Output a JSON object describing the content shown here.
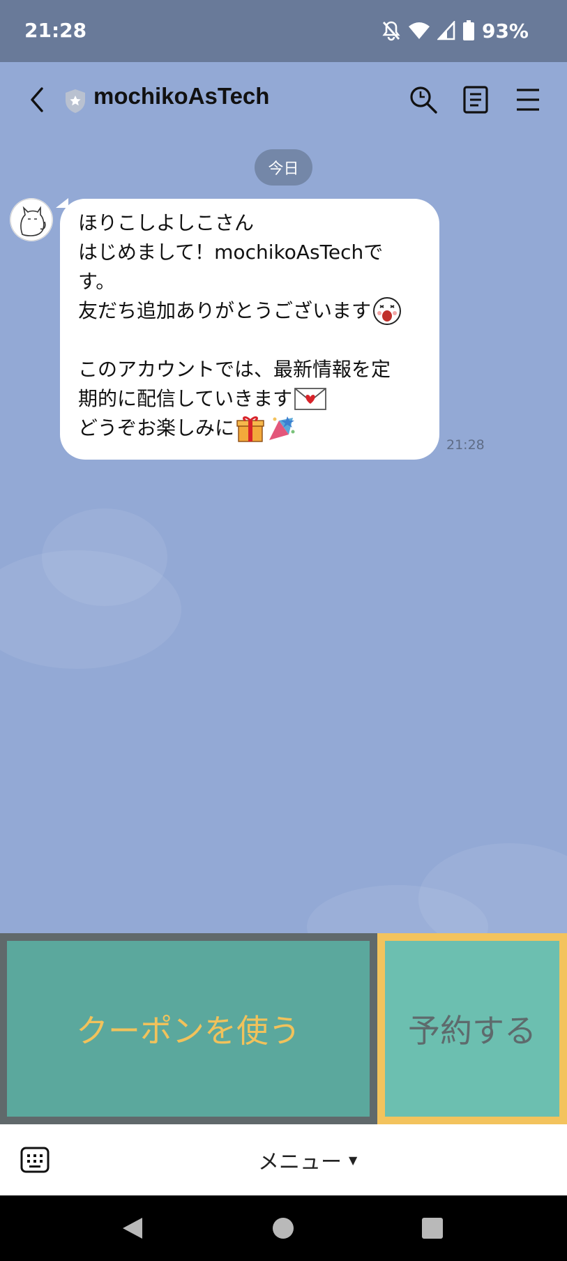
{
  "status_bar": {
    "time": "21:28",
    "battery": "93%",
    "icons": [
      "notifications-off-icon",
      "wifi-icon",
      "signal-icon",
      "battery-icon"
    ]
  },
  "header": {
    "title": "mochikoAsTech",
    "icons": [
      "back-arrow-icon",
      "official-badge-icon",
      "search-icon",
      "notes-icon",
      "hamburger-menu-icon"
    ]
  },
  "chat": {
    "date_label": "今日",
    "message": {
      "lines": [
        "ほりこしよしこさん",
        "はじめまして！mochikoAsTechで",
        "す。",
        "友だち追加ありがとうございます",
        "",
        "このアカウントでは、最新情報を定",
        "期的に配信していきます",
        "どうぞお楽しみに"
      ],
      "time": "21:28"
    }
  },
  "rich_menu": {
    "left_label": "クーポンを使う",
    "right_label": "予約する",
    "colors": {
      "left_bg": "#5ba89d",
      "left_text": "#f1c25b",
      "right_bg": "#6cbfb0",
      "right_border": "#f3c35d",
      "right_text": "#5e6a6c"
    }
  },
  "input_bar": {
    "menu_label": "メニュー",
    "icons": [
      "keyboard-icon",
      "caret-down-icon"
    ]
  }
}
